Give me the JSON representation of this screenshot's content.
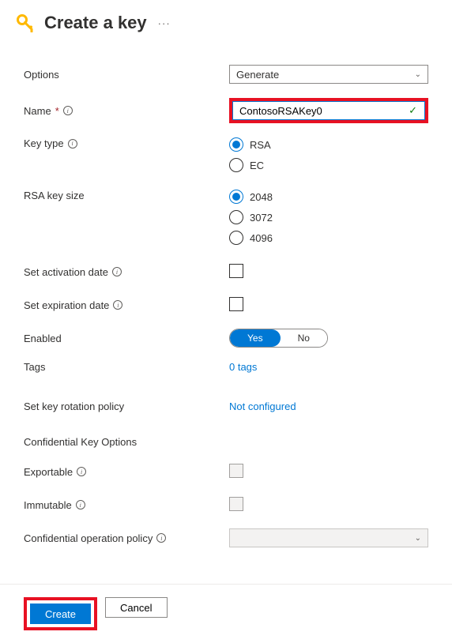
{
  "header": {
    "title": "Create a key"
  },
  "labels": {
    "options": "Options",
    "name": "Name",
    "keyType": "Key type",
    "rsaKeySize": "RSA key size",
    "setActivationDate": "Set activation date",
    "setExpirationDate": "Set expiration date",
    "enabled": "Enabled",
    "tags": "Tags",
    "setKeyRotation": "Set key rotation policy",
    "confidentialHeading": "Confidential Key Options",
    "exportable": "Exportable",
    "immutable": "Immutable",
    "confidentialOpPolicy": "Confidential operation policy"
  },
  "values": {
    "optionsSelected": "Generate",
    "nameInput": "ContosoRSAKey0",
    "tagsLink": "0 tags",
    "rotationLink": "Not configured"
  },
  "keyType": {
    "options": [
      {
        "label": "RSA",
        "selected": true
      },
      {
        "label": "EC",
        "selected": false
      }
    ]
  },
  "rsaKeySize": {
    "options": [
      {
        "label": "2048",
        "selected": true
      },
      {
        "label": "3072",
        "selected": false
      },
      {
        "label": "4096",
        "selected": false
      }
    ]
  },
  "toggle": {
    "yes": "Yes",
    "no": "No"
  },
  "footer": {
    "create": "Create",
    "cancel": "Cancel"
  }
}
